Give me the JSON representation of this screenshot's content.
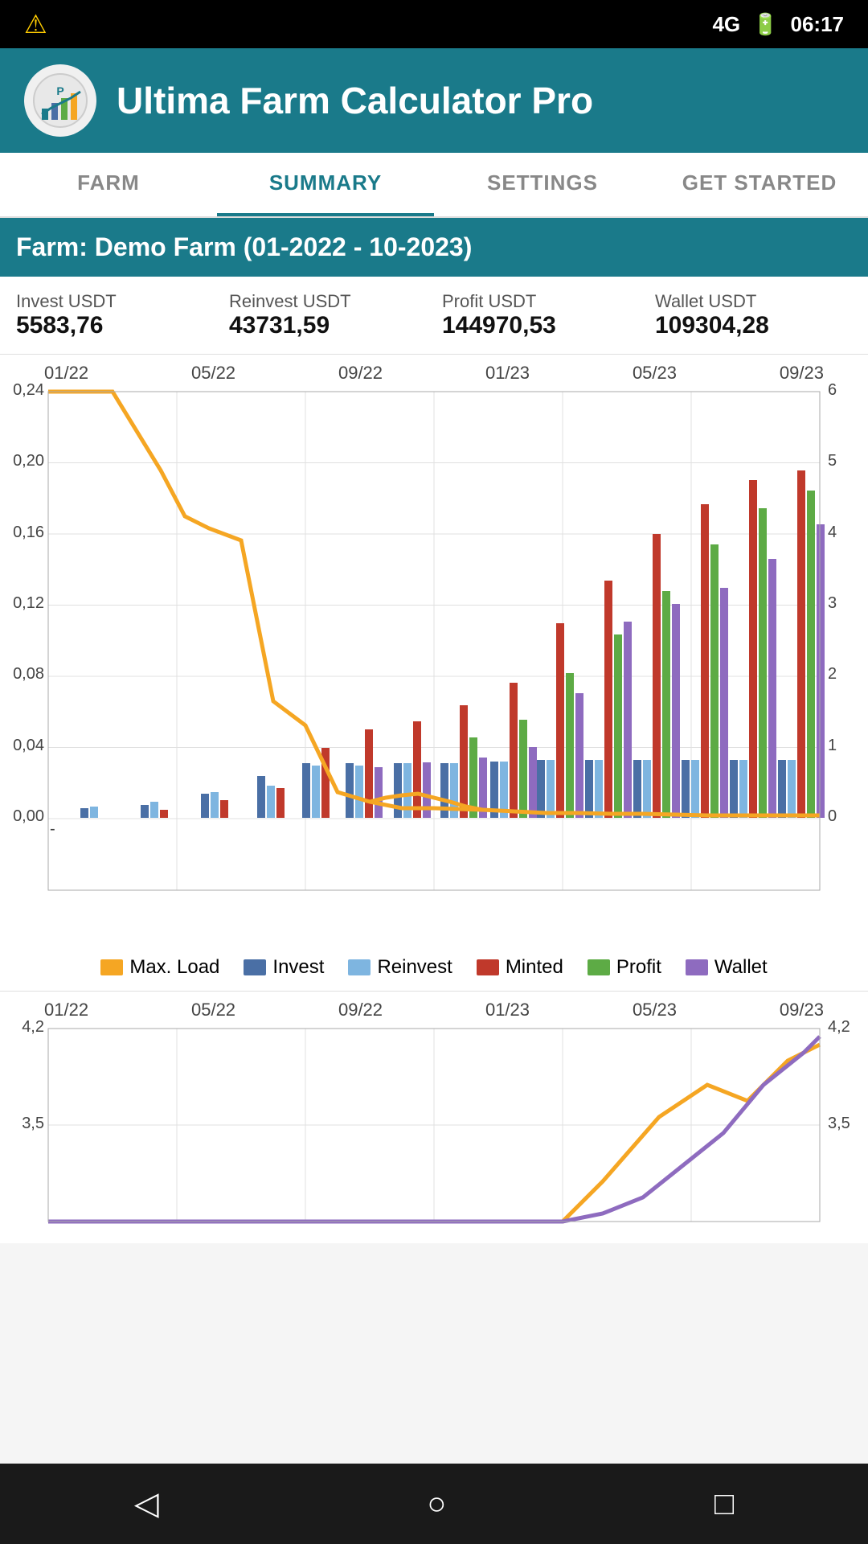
{
  "statusBar": {
    "warning": "⚠",
    "signal": "4G",
    "battery": "🔋",
    "time": "06:17"
  },
  "header": {
    "title": "Ultima Farm Calculator Pro",
    "logoSymbol": "📊"
  },
  "tabs": [
    {
      "label": "FARM",
      "active": false
    },
    {
      "label": "SUMMARY",
      "active": true
    },
    {
      "label": "SETTINGS",
      "active": false
    },
    {
      "label": "GET STARTED",
      "active": false
    }
  ],
  "farmHeader": "Farm:  Demo Farm (01-2022 - 10-2023)",
  "stats": [
    {
      "label": "Invest USDT",
      "value": "5583,76"
    },
    {
      "label": "Reinvest USDT",
      "value": "43731,59"
    },
    {
      "label": "Profit USDT",
      "value": "144970,53"
    },
    {
      "label": "Wallet USDT",
      "value": "109304,28"
    }
  ],
  "chart1": {
    "xLabels": [
      "01/22",
      "05/22",
      "09/22",
      "01/23",
      "05/23",
      "09/23"
    ],
    "yLabelsLeft": [
      "0,24",
      "0,20",
      "0,16",
      "0,12",
      "0,08",
      "0,04",
      "0,00"
    ],
    "yLabelsRight": [
      "6",
      "5",
      "4",
      "3",
      "2",
      "1",
      "0"
    ]
  },
  "legend": [
    {
      "label": "Max. Load",
      "color": "#f5a623"
    },
    {
      "label": "Invest",
      "color": "#4a6fa5"
    },
    {
      "label": "Reinvest",
      "color": "#7eb5e0"
    },
    {
      "label": "Minted",
      "color": "#c0392b"
    },
    {
      "label": "Profit",
      "color": "#5dab45"
    },
    {
      "label": "Wallet",
      "color": "#8e6bbf"
    }
  ],
  "chart2": {
    "xLabels": [
      "01/22",
      "05/22",
      "09/22",
      "01/23",
      "05/23",
      "09/23"
    ],
    "yLabelsLeft": [
      "4,2",
      "3,5"
    ],
    "yLabelsRight": [
      "4,2",
      "3,5"
    ]
  },
  "navBar": {
    "back": "◁",
    "home": "○",
    "recent": "□"
  }
}
